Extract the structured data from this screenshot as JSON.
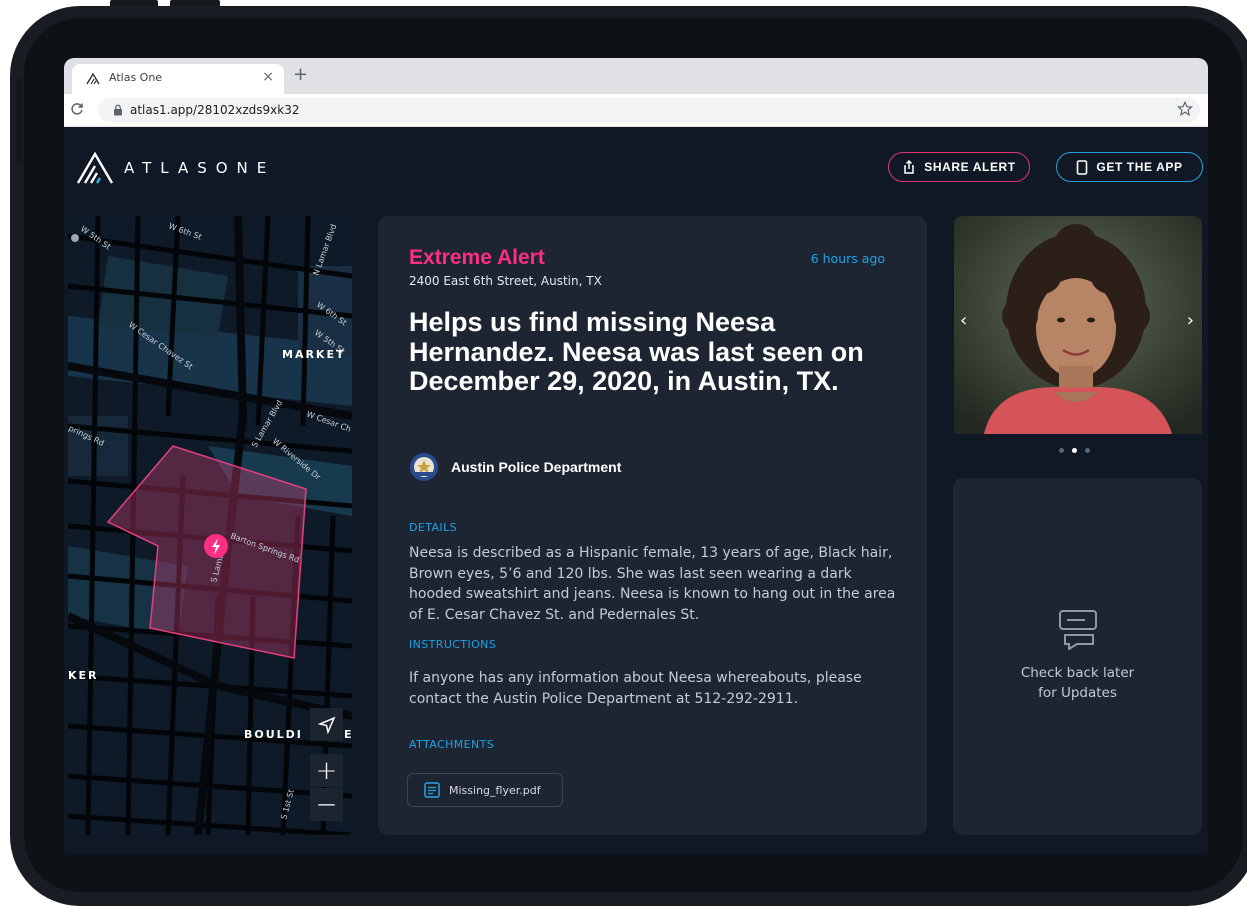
{
  "browser": {
    "tab_title": "Atlas One",
    "tab_close": "×",
    "new_tab": "+",
    "url": "atlas1.app/28102xzds9xk32"
  },
  "header": {
    "logo_text": "ATLASONE",
    "share_label": "SHARE ALERT",
    "app_label": "GET THE APP"
  },
  "map": {
    "labels": [
      "W 5th St",
      "W 6th St",
      "N Lamar Blvd",
      "W Cesar Chavez St",
      "W 6th St",
      "W 5th St",
      "MARKET",
      "W Cesar Ch",
      "S Lamar Blvd",
      "prings Rd",
      "W Riverside Dr",
      "Barton Springs Rd",
      "S Lamar",
      "KER",
      "BOULDI",
      "E",
      "S 1st St"
    ],
    "zoom_in": "+",
    "zoom_out": "—"
  },
  "alert": {
    "level": "Extreme Alert",
    "time_ago": "6 hours ago",
    "address": "2400 East 6th Street, Austin, TX",
    "headline": "Helps us find missing Neesa Hernandez. Neesa was last seen on December 29, 2020, in Austin, TX.",
    "agency": "Austin Police Department",
    "details_label": "DETAILS",
    "details": "Neesa is described as a Hispanic female, 13 years of age, Black hair, Brown eyes, 5’6 and 120 lbs. She was last seen wearing a dark hooded sweatshirt and jeans. Neesa is known to hang out in the area of E. Cesar Chavez St. and Pedernales St.",
    "instructions_label": "INSTRUCTIONS",
    "instructions": "If anyone has any information about Neesa whereabouts, please contact the Austin Police Department at 512-292-2911.",
    "attachments_label": "ATTACHMENTS",
    "attachment_file": "Missing_flyer.pdf"
  },
  "carousel": {
    "prev": "‹",
    "next": "›",
    "total": 3,
    "active_index": 1
  },
  "updates": {
    "text": "Check back later for Updates"
  },
  "colors": {
    "alert_pink": "#ff2d84",
    "accent_blue": "#1aa4e6",
    "background": "#101826",
    "card": "#1d2532"
  },
  "icons": [
    "tab-favicon-icon",
    "reload-icon",
    "lock-icon",
    "star-icon",
    "share-icon",
    "phone-icon",
    "location-arrow-icon",
    "lightning-icon",
    "police-badge-icon",
    "document-icon",
    "chat-icon"
  ]
}
